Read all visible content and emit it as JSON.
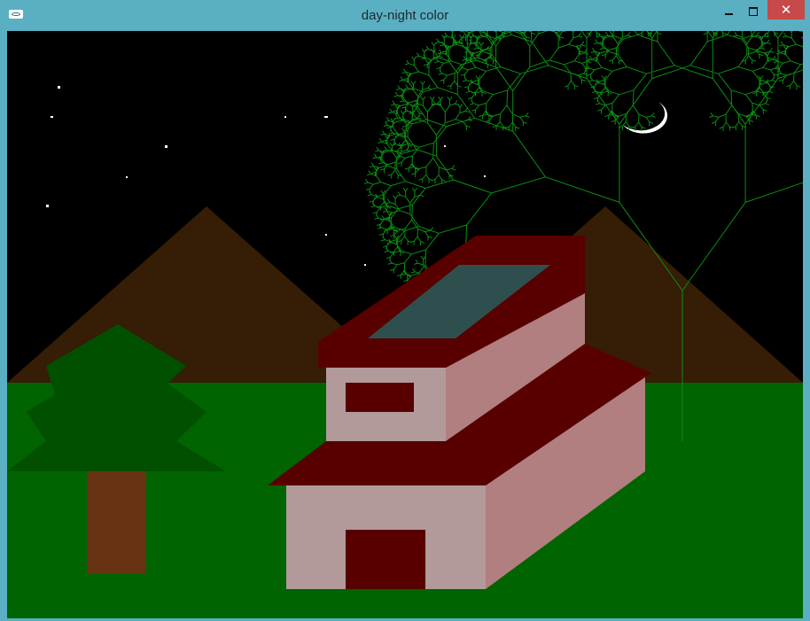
{
  "window": {
    "title": "day-night color",
    "close_glyph": "✕"
  },
  "icons": {
    "app": "app-window-icon",
    "minimize": "minimize-icon",
    "maximize": "maximize-icon",
    "close": "close-icon"
  },
  "scene": {
    "mode": "night",
    "colors": {
      "sky": "#000000",
      "ground": "#006400",
      "mountain": "#361d05",
      "star": "#ffffff",
      "moon": "#ffffff",
      "pine": "#005000",
      "pine_trunk": "#673312",
      "house_wall_front": "#b29a9b",
      "house_wall_side": "#b17f7f",
      "roof": "#580000",
      "door": "#580000",
      "skylight": "#2f4f4f",
      "fractal_tree": "#0a8f12"
    }
  }
}
